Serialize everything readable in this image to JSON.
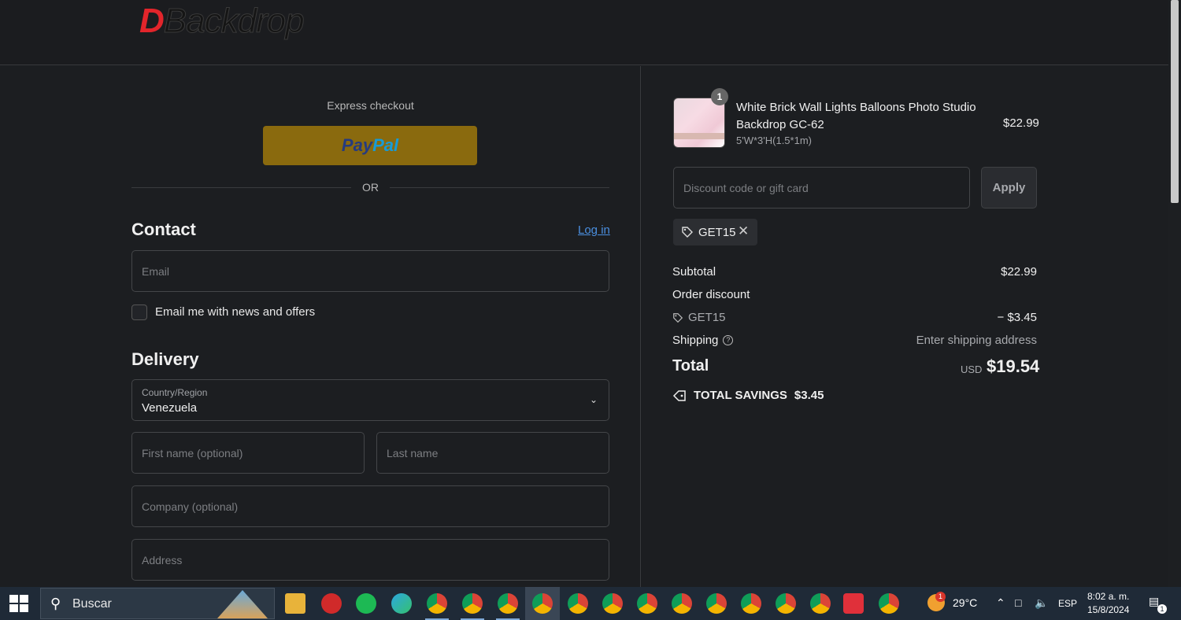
{
  "brand": {
    "logo_d": "D",
    "logo_rest": "Backdrop"
  },
  "express": {
    "title": "Express checkout",
    "paypal_part1": "Pay",
    "paypal_part2": "Pal",
    "or_label": "OR"
  },
  "contact": {
    "heading": "Contact",
    "login_label": "Log in",
    "email_placeholder": "Email",
    "newsletter_label": "Email me with news and offers"
  },
  "delivery": {
    "heading": "Delivery",
    "country_label": "Country/Region",
    "country_value": "Venezuela",
    "first_name_placeholder": "First name (optional)",
    "last_name_placeholder": "Last name",
    "company_placeholder": "Company (optional)",
    "address_placeholder": "Address"
  },
  "cart": {
    "item": {
      "quantity": "1",
      "title": "White Brick Wall Lights Balloons Photo Studio Backdrop GC-62",
      "variant": "5'W*3'H(1.5*1m)",
      "price": "$22.99"
    },
    "discount_placeholder": "Discount code or gift card",
    "apply_label": "Apply",
    "applied_code": "GET15",
    "subtotal_label": "Subtotal",
    "subtotal_value": "$22.99",
    "order_discount_label": "Order discount",
    "discount_code": "GET15",
    "discount_value": "− $3.45",
    "shipping_label": "Shipping",
    "shipping_value": "Enter shipping address",
    "total_label": "Total",
    "currency": "USD",
    "total_value": "$19.54",
    "savings_label": "TOTAL SAVINGS",
    "savings_value": "$3.45"
  },
  "taskbar": {
    "search_label": "Buscar",
    "weather": "29°C",
    "language": "ESP",
    "time": "8:02 a. m.",
    "date": "15/8/2024",
    "notifications": "1",
    "weather_badge": "1"
  },
  "colors": {
    "accent_link": "#4a8fe0",
    "paypal_bg": "#8a6a0e",
    "logo_red": "#e2252b"
  }
}
